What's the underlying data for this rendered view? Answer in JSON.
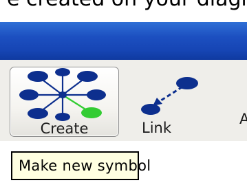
{
  "caption": {
    "text": "e created on your diagram"
  },
  "window": {
    "title_bar_color": "#1c4fc0"
  },
  "toolbar": {
    "background": "#efeeea",
    "buttons": [
      {
        "id": "create",
        "label": "Create",
        "icon": "hub-network-icon",
        "selected": true
      },
      {
        "id": "link",
        "label": "Link",
        "icon": "link-arrow-icon",
        "selected": false
      }
    ],
    "partial_label": "A"
  },
  "tooltip": {
    "text": "Make new symbol"
  },
  "colors": {
    "node_blue": "#0d2f8e",
    "node_green": "#33cc33"
  }
}
